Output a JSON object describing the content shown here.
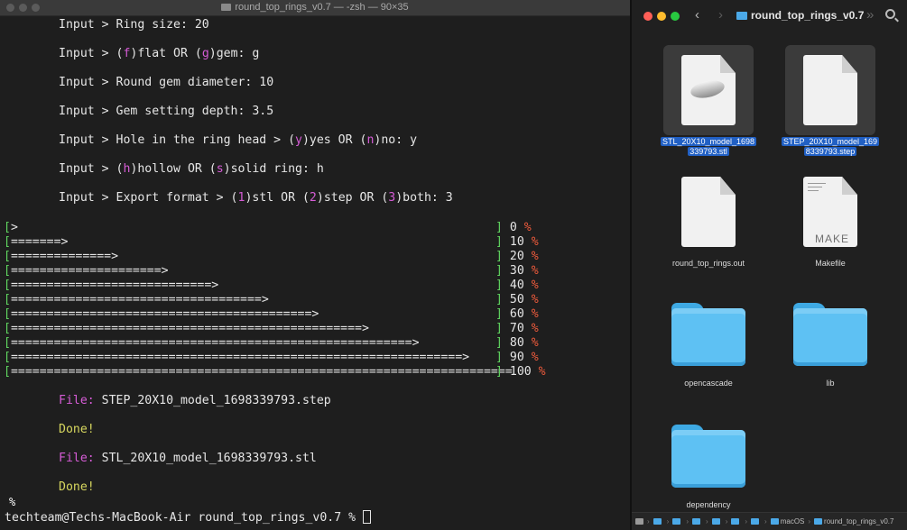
{
  "terminal": {
    "title": "round_top_rings_v0.7 — -zsh — 90×35",
    "prompts": [
      {
        "pre": "Input > Ring size: 20",
        "parts": []
      },
      {
        "parts": [
          {
            "t": "Input > (",
            "c": ""
          },
          {
            "t": "f",
            "c": "key"
          },
          {
            "t": ")flat OR (",
            "c": ""
          },
          {
            "t": "g",
            "c": "key"
          },
          {
            "t": ")gem: g",
            "c": ""
          }
        ]
      },
      {
        "parts": [
          {
            "t": "Input > Round gem diameter: 10",
            "c": ""
          }
        ]
      },
      {
        "parts": [
          {
            "t": "Input > Gem setting depth: 3.5",
            "c": ""
          }
        ]
      },
      {
        "parts": [
          {
            "t": "Input > Hole in the ring head > (",
            "c": ""
          },
          {
            "t": "y",
            "c": "key"
          },
          {
            "t": ")yes OR (",
            "c": ""
          },
          {
            "t": "n",
            "c": "key"
          },
          {
            "t": ")no: y",
            "c": ""
          }
        ]
      },
      {
        "parts": [
          {
            "t": "Input > (",
            "c": ""
          },
          {
            "t": "h",
            "c": "key"
          },
          {
            "t": ")hollow OR (",
            "c": ""
          },
          {
            "t": "s",
            "c": "key"
          },
          {
            "t": ")solid ring: h",
            "c": ""
          }
        ]
      },
      {
        "parts": [
          {
            "t": "Input > Export format > (",
            "c": ""
          },
          {
            "t": "1",
            "c": "key"
          },
          {
            "t": ")stl OR (",
            "c": ""
          },
          {
            "t": "2",
            "c": "key"
          },
          {
            "t": ")step OR (",
            "c": ""
          },
          {
            "t": "3",
            "c": "key"
          },
          {
            "t": ")both: 3",
            "c": ""
          }
        ]
      }
    ],
    "progress": [
      {
        "bar": ">",
        "value": "0"
      },
      {
        "bar": "=======>",
        "value": "10"
      },
      {
        "bar": "==============>",
        "value": "20"
      },
      {
        "bar": "=====================>",
        "value": "30"
      },
      {
        "bar": "============================>",
        "value": "40"
      },
      {
        "bar": "===================================>",
        "value": "50"
      },
      {
        "bar": "==========================================>",
        "value": "60"
      },
      {
        "bar": "=================================================>",
        "value": "70"
      },
      {
        "bar": "========================================================>",
        "value": "80"
      },
      {
        "bar": "===============================================================>",
        "value": "90"
      },
      {
        "bar": "======================================================================",
        "value": "100"
      }
    ],
    "pct_symbol": "%",
    "file_label": "File:",
    "file1": "STEP_20X10_model_1698339793.step",
    "done1": "Done!",
    "file2": "STL_20X10_model_1698339793.stl",
    "done2": "Done!",
    "bell_glyph": "%",
    "prompt": "techteam@Techs-MacBook-Air round_top_rings_v0.7 % "
  },
  "finder": {
    "title": "round_top_rings_v0.7",
    "back": "‹",
    "forward": "›",
    "more": "»",
    "files": [
      {
        "name_l1": "STL_20X10_model_1698",
        "name_l2": "339793.stl",
        "selected": true,
        "kind": "stl"
      },
      {
        "name_l1": "STEP_20X10_model_169",
        "name_l2": "8339793.step",
        "selected": true,
        "kind": "doc"
      },
      {
        "name_l1": "round_top_rings.out",
        "name_l2": "",
        "selected": false,
        "kind": "doc"
      },
      {
        "name_l1": "Makefile",
        "name_l2": "",
        "selected": false,
        "kind": "makefile"
      },
      {
        "name_l1": "opencascade",
        "name_l2": "",
        "selected": false,
        "kind": "folder"
      },
      {
        "name_l1": "lib",
        "name_l2": "",
        "selected": false,
        "kind": "folder"
      },
      {
        "name_l1": "dependency",
        "name_l2": "",
        "selected": false,
        "kind": "folder"
      }
    ],
    "makefile_label": "MAKE",
    "pathbar": [
      "",
      "",
      "",
      "",
      "",
      "",
      "",
      "macOS",
      "round_top_rings_v0.7"
    ],
    "pathbar_sep": "›"
  },
  "colors": {
    "selection": "#2160c4",
    "folder": "#5ec1f3",
    "pct": "#ef5b3c",
    "key": "#d65cd6",
    "bracket": "#5fd35f",
    "done": "#d7d75f"
  }
}
